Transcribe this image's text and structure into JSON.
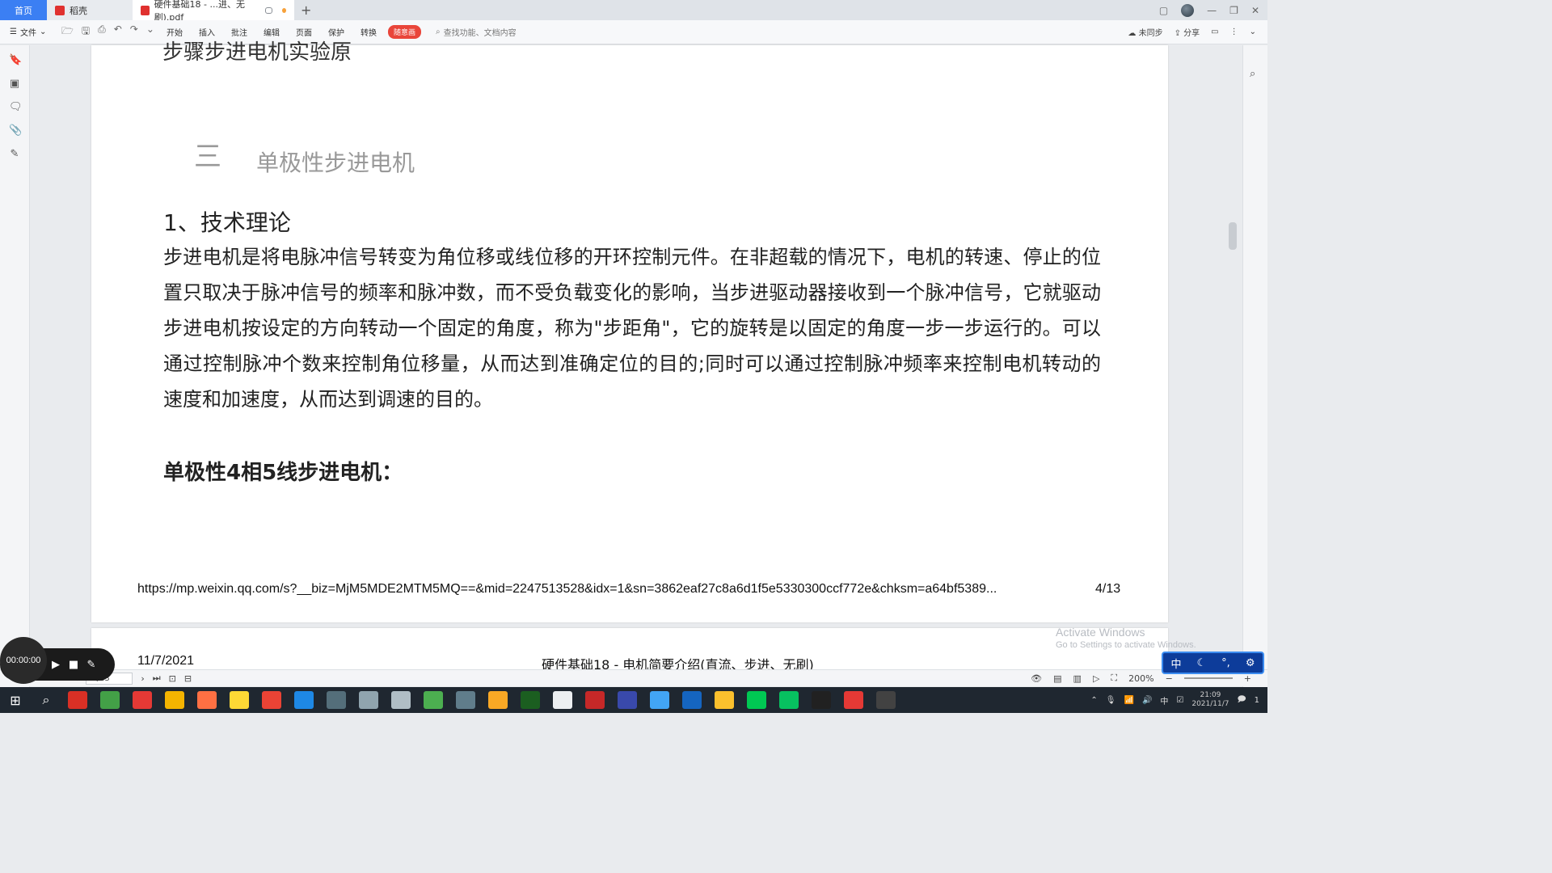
{
  "tabs": {
    "home": "首页",
    "daoke": "稻壳",
    "pdf": "硬件基础18 - ...进、无刷).pdf",
    "new_tab": "+"
  },
  "ribbon": {
    "file": "文件",
    "tabs": [
      "开始",
      "插入",
      "批注",
      "编辑",
      "页面",
      "保护",
      "转换"
    ],
    "hot": "随意画",
    "search_placeholder": "查找功能、文档内容",
    "sync": "未同步",
    "share": "分享"
  },
  "document": {
    "cut_top": "步骤步进电机实验原",
    "section_num": "三",
    "section_title": "单极性步进电机",
    "heading": "1、技术理论",
    "paragraph": "步进电机是将电脉冲信号转变为角位移或线位移的开环控制元件。在非超载的情况下，电机的转速、停止的位置只取决于脉冲信号的频率和脉冲数，而不受负载变化的影响，当步进驱动器接收到一个脉冲信号，它就驱动步进电机按设定的方向转动一个固定的角度，称为\"步距角\"，它的旋转是以固定的角度一步一步运行的。可以通过控制脉冲个数来控制角位移量，从而达到准确定位的目的;同时可以通过控制脉冲频率来控制电机转动的速度和加速度，从而达到调速的目的。",
    "subheading": "单极性4相5线步进电机：",
    "footer_url": "https://mp.weixin.qq.com/s?__biz=MjM5MDE2MTM5MQ==&mid=2247513528&idx=1&sn=3862eaf27c8a6d1f5e5330300ccf772e&chksm=a64bf5389...",
    "footer_page": "4/13",
    "next_date": "11/7/2021",
    "next_title": "硬件基础18 - 电机简要介绍(直流、步进、无刷)"
  },
  "watermark": {
    "line1": "Activate Windows",
    "line2": "Go to Settings to activate Windows."
  },
  "statusbar": {
    "page": "4/13",
    "zoom": "200%"
  },
  "recorder": {
    "time": "00:00:00"
  },
  "ime": {
    "lang": "中"
  },
  "taskbar": {
    "time": "21:09",
    "date": "2021/11/7",
    "ime": "中",
    "notif": "1",
    "app_colors": [
      "#d93025",
      "#43a047",
      "#e53935",
      "#f4b400",
      "#ff7043",
      "#fdd835",
      "#ea4335",
      "#1e88e5",
      "#546e7a",
      "#90a4ae",
      "#b0bec5",
      "#4caf50",
      "#607d8b",
      "#f9a825",
      "#1b5e20",
      "#eceff1",
      "#c62828",
      "#3949ab",
      "#42a5f5",
      "#1565c0",
      "#fbc02d",
      "#00c853",
      "#07c160",
      "#212121",
      "#e53935",
      "#424242"
    ]
  }
}
